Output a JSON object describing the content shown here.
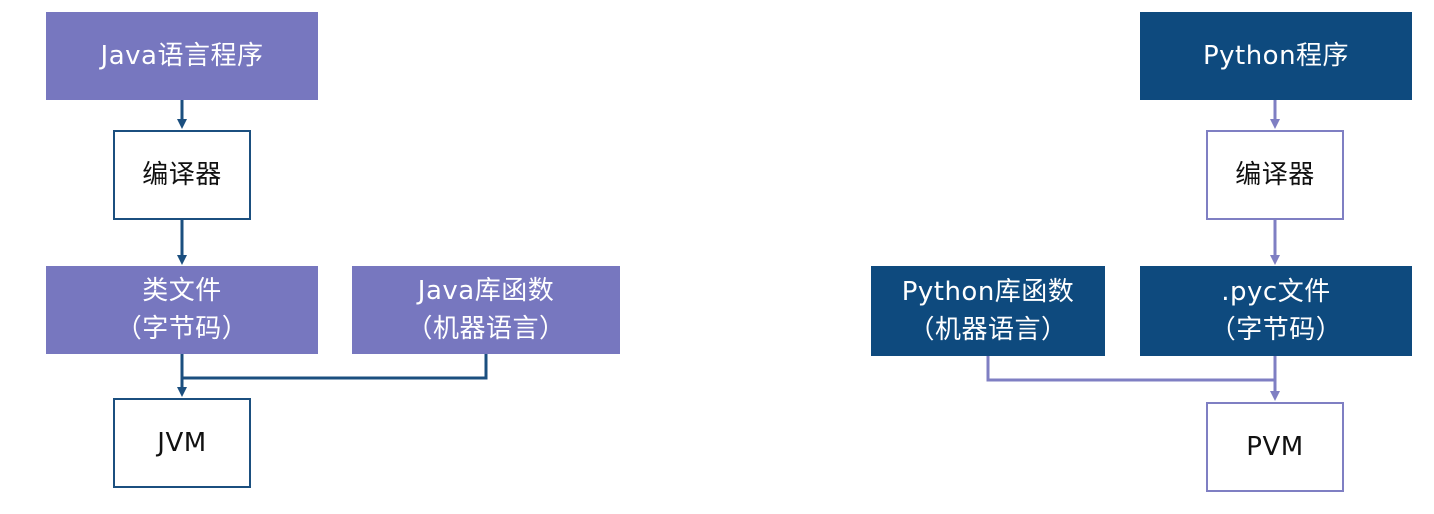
{
  "colors": {
    "purple_fill": "#7777bf",
    "navy_fill": "#0e4a7e",
    "navy_line": "#1b4f7f",
    "purple_line": "#7f7fc3"
  },
  "java": {
    "program": "Java语言程序",
    "compiler": "编译器",
    "class_file": {
      "line1": "类文件",
      "line2": "（字节码）"
    },
    "library": {
      "line1": "Java库函数",
      "line2": "（机器语言）"
    },
    "vm": "JVM"
  },
  "python": {
    "program": "Python程序",
    "compiler": "编译器",
    "library": {
      "line1": "Python库函数",
      "line2": "（机器语言）"
    },
    "pyc_file": {
      "line1": ".pyc文件",
      "line2": "（字节码）"
    },
    "vm": "PVM"
  }
}
